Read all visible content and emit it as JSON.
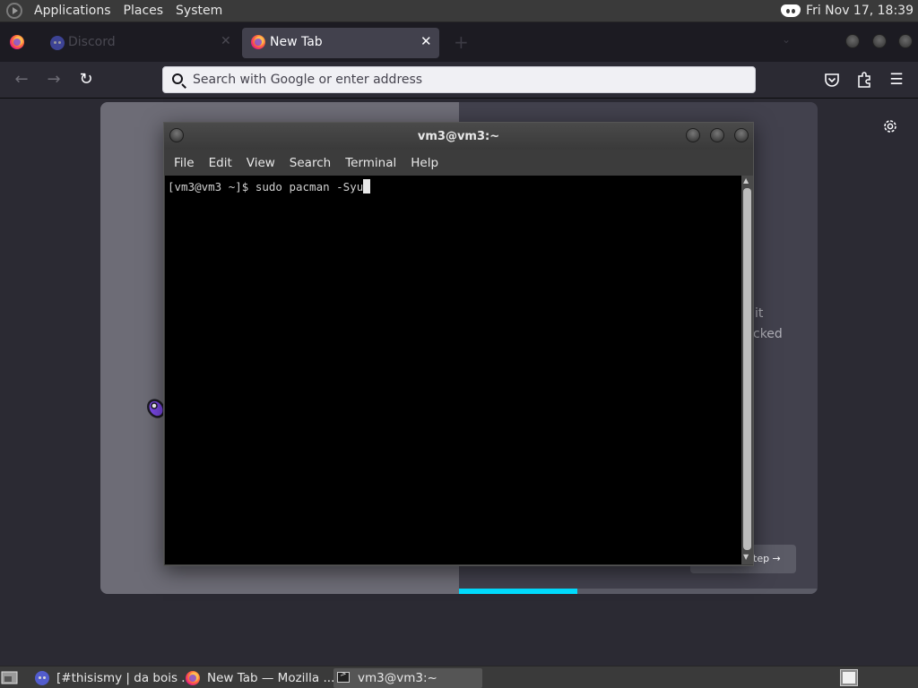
{
  "top_panel": {
    "menus": [
      "Applications",
      "Places",
      "System"
    ],
    "clock": "Fri Nov 17, 18:39",
    "tray_icons": [
      "discord-icon"
    ]
  },
  "browser": {
    "tabs": [
      {
        "title": "Discord",
        "icon": "discord-icon",
        "active": false
      },
      {
        "title": "New Tab",
        "icon": "firefox-icon",
        "active": true
      }
    ],
    "close_glyph": "✕",
    "new_tab_glyph": "+",
    "tab_list_glyph": "⌄",
    "nav": {
      "back_glyph": "←",
      "forward_glyph": "→",
      "reload_glyph": "↻",
      "url_placeholder": "Search with Google or enter address",
      "menu_glyph": "☰"
    },
    "page": {
      "fragment_line_1": "it",
      "fragment_line_2": "cked",
      "next_button_label": "tep →",
      "progress_fraction": 0.33
    }
  },
  "terminal": {
    "title": "vm3@vm3:~",
    "menu": [
      "File",
      "Edit",
      "View",
      "Search",
      "Terminal",
      "Help"
    ],
    "prompt_line": "[vm3@vm3 ~]$ sudo pacman -Syu"
  },
  "taskbar": {
    "items": [
      {
        "label": "[#thisismy | da bois ...",
        "icon": "discord-icon"
      },
      {
        "label": "New Tab — Mozilla ...",
        "icon": "firefox-icon"
      },
      {
        "label": "vm3@vm3:~",
        "icon": "terminal-icon"
      }
    ]
  },
  "colors": {
    "accent_progress": "#00ddff",
    "browser_toolbar": "#2b2a33",
    "tab_strip": "#1c1b22",
    "panel": "#3a3a3a",
    "terminal_bg": "#000000"
  }
}
